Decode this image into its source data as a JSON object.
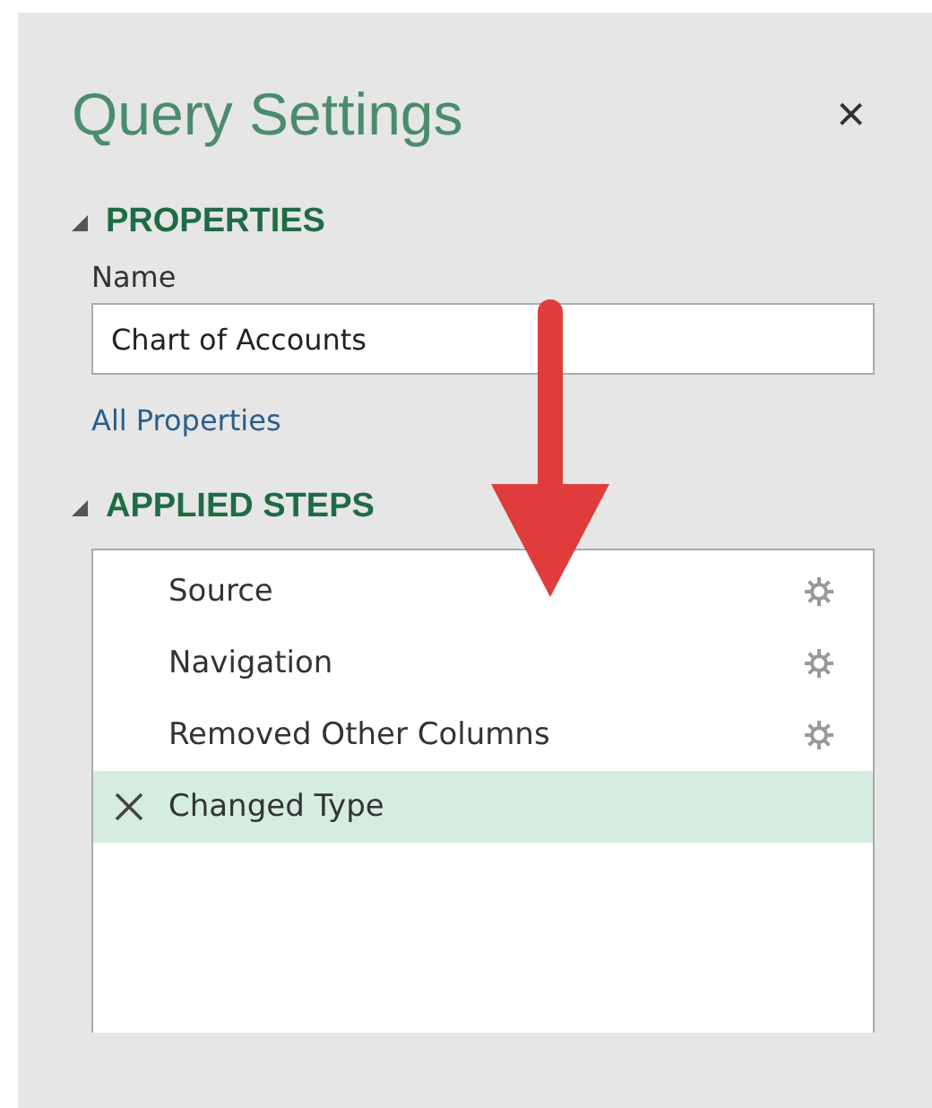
{
  "panel": {
    "title": "Query Settings",
    "close": "×"
  },
  "properties": {
    "heading": "PROPERTIES",
    "expanded": true,
    "name_label": "Name",
    "name_value": "Chart of Accounts",
    "link": "All Properties"
  },
  "applied_steps": {
    "heading": "APPLIED STEPS",
    "expanded": true,
    "steps": [
      {
        "label": "Source",
        "selected": false,
        "has_settings": true
      },
      {
        "label": "Navigation",
        "selected": false,
        "has_settings": true
      },
      {
        "label": "Removed Other Columns",
        "selected": false,
        "has_settings": true
      },
      {
        "label": "Changed Type",
        "selected": true,
        "has_settings": false
      }
    ]
  }
}
